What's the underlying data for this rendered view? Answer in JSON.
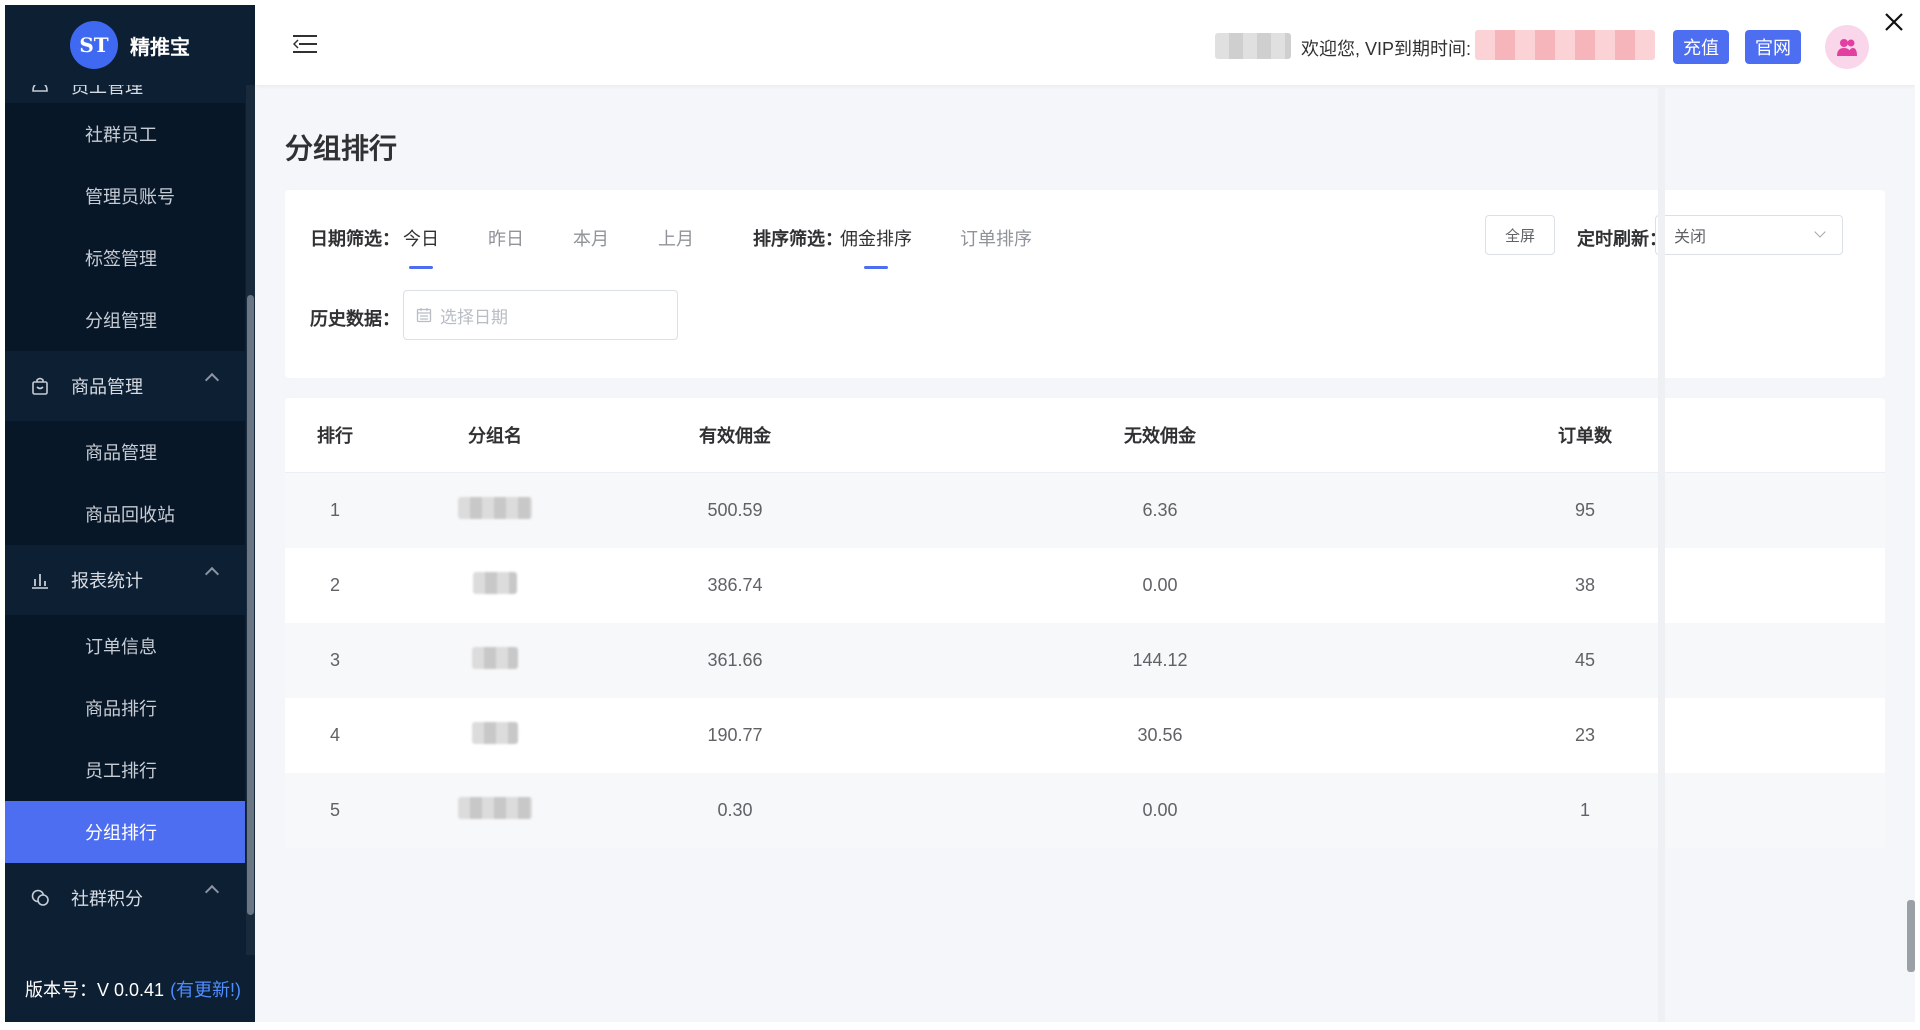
{
  "app": {
    "logo_text": "精推宝",
    "logo_glyph": "ST"
  },
  "sidebar": {
    "partial_top_label": "员工管理",
    "groups": [
      {
        "label": "商品管理",
        "icon": "bag-icon"
      },
      {
        "label": "报表统计",
        "icon": "bar-chart-icon"
      },
      {
        "label": "社群积分",
        "icon": "chat-icon"
      }
    ],
    "staff_items": [
      "社群员工",
      "管理员账号",
      "标签管理",
      "分组管理"
    ],
    "goods_items": [
      "商品管理",
      "商品回收站"
    ],
    "report_items": [
      "订单信息",
      "商品排行",
      "员工排行",
      "分组排行"
    ],
    "version_label": "版本号：V 0.0.41",
    "version_link": "(有更新!)"
  },
  "header": {
    "welcome_text": "欢迎您, VIP到期时间:",
    "recharge_label": "充值",
    "official_label": "官网"
  },
  "page": {
    "title": "分组排行"
  },
  "filters": {
    "date_label": "日期筛选：",
    "date_options": [
      "今日",
      "昨日",
      "本月",
      "上月"
    ],
    "date_active": "今日",
    "sort_label": "排序筛选：",
    "sort_options": [
      "佣金排序",
      "订单排序"
    ],
    "sort_active": "佣金排序",
    "fullscreen_label": "全屏",
    "refresh_label": "定时刷新：",
    "refresh_value": "关闭",
    "history_label": "历史数据：",
    "date_placeholder": "选择日期"
  },
  "table": {
    "headers": [
      "排行",
      "分组名",
      "有效佣金",
      "无效佣金",
      "订单数"
    ],
    "rows": [
      {
        "rank": "1",
        "valid": "500.59",
        "invalid": "6.36",
        "orders": "95"
      },
      {
        "rank": "2",
        "valid": "386.74",
        "invalid": "0.00",
        "orders": "38"
      },
      {
        "rank": "3",
        "valid": "361.66",
        "invalid": "144.12",
        "orders": "45"
      },
      {
        "rank": "4",
        "valid": "190.77",
        "invalid": "30.56",
        "orders": "23"
      },
      {
        "rank": "5",
        "valid": "0.30",
        "invalid": "0.00",
        "orders": "1"
      }
    ]
  },
  "colors": {
    "accent": "#4e6ef2",
    "sidebar_bg": "#0d1f33",
    "sidebar_sub_bg": "#081727"
  }
}
